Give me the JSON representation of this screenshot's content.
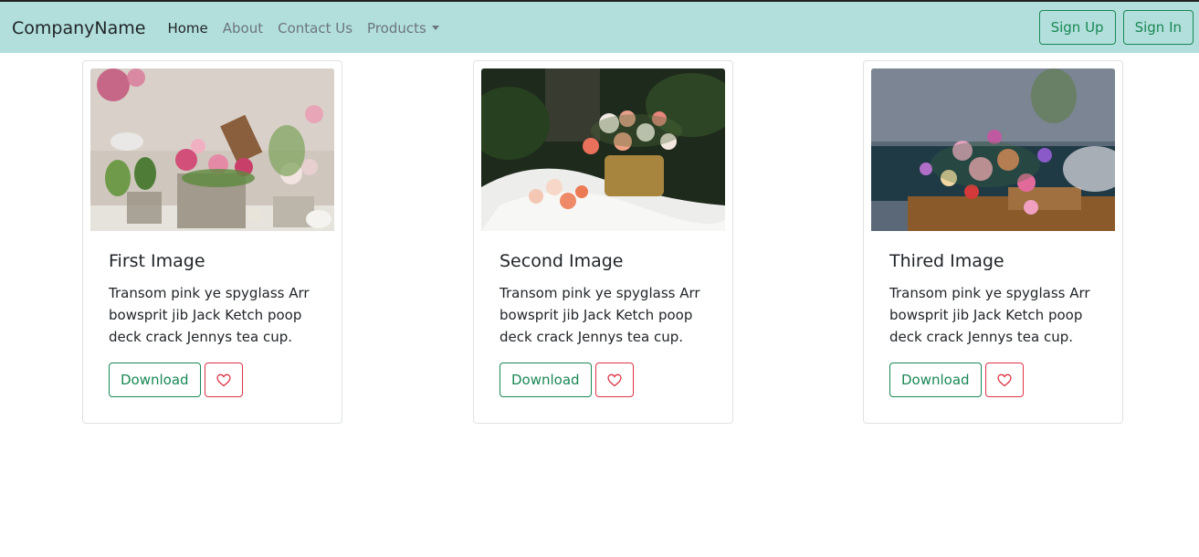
{
  "navbar": {
    "brand": "CompanyName",
    "links": [
      {
        "label": "Home",
        "active": true
      },
      {
        "label": "About"
      },
      {
        "label": "Contact Us"
      }
    ],
    "products_label": "Products",
    "sign_up": "Sign Up",
    "sign_in": "Sign In"
  },
  "cards": [
    {
      "title": "First Image",
      "text": "Transom pink ye spyglass Arr bowsprit jib Jack Ketch poop deck crack Jennys tea cup.",
      "download": "Download"
    },
    {
      "title": "Second Image",
      "text": "Transom pink ye spyglass Arr bowsprit jib Jack Ketch poop deck crack Jennys tea cup.",
      "download": "Download"
    },
    {
      "title": "Thired Image",
      "text": "Transom pink ye spyglass Arr bowsprit jib Jack Ketch poop deck crack Jennys tea cup.",
      "download": "Download"
    }
  ],
  "colors": {
    "navbar_bg": "#b2dfdb",
    "success": "#198754",
    "danger": "#dc3545"
  },
  "icons": [
    "heart-icon",
    "chevron-down-icon"
  ]
}
